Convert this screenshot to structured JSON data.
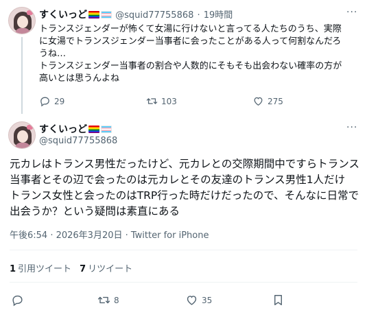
{
  "tweet1": {
    "display_name": "すくいっど",
    "handle": "@squid77755868",
    "time": "19時間",
    "separator": "·",
    "lines": [
      "トランスジェンダーが怖くて女湯に行けないと言ってる人たちのうち、実際",
      "に女湯でトランスジェンダー当事者に会ったことがある人って何割なんだろ",
      "うね…",
      "トランスジェンダー当事者の割合や人数的にそもそも出会わない確率の方が",
      "高いとは思うんよね"
    ],
    "replies": "29",
    "retweets": "103",
    "likes": "275"
  },
  "tweet2": {
    "display_name": "すくいっど",
    "handle": "@squid77755868",
    "lines": [
      "元カレはトランス男性だったけど、元カレとの交際期間中ですらトランス",
      "当事者とその辺で会ったのは元カレとその友達のトランス男性1人だけ",
      "トランス女性と会ったのはTRP行った時だけだったので、そんなに日常で",
      "出会うか？という疑問は素直にある"
    ],
    "timestamp": "午後6:54 · 2026年3月20日 · Twitter for iPhone",
    "quote_count": "1",
    "quote_label": "引用ツイート",
    "retweet_count": "7",
    "retweet_label": "リツイート",
    "retweets": "8",
    "likes": "35"
  },
  "icons": [
    "more-icon",
    "reply-icon",
    "retweet-icon",
    "like-icon",
    "bookmark-icon",
    "rainbow-flag-emoji",
    "transgender-flag-emoji"
  ],
  "colors": {
    "text": "#0f1419",
    "muted": "#536471",
    "divider": "#eff3f4",
    "thread_line": "#cfd9de"
  }
}
